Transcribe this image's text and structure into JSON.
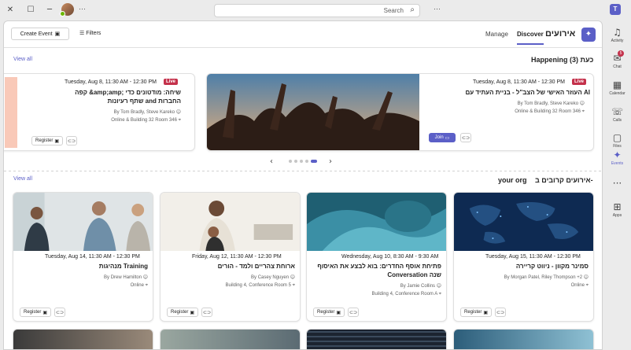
{
  "window": {
    "minimize": "─",
    "maximize": "☐",
    "close": "✕",
    "more": "···"
  },
  "search": {
    "placeholder": "Search"
  },
  "topbar": {
    "more": "···"
  },
  "rail": [
    {
      "label": "Activity",
      "icon": "bell-icon",
      "glyph": "🔔"
    },
    {
      "label": "Chat",
      "icon": "chat-icon",
      "glyph": "💬",
      "badge": "5"
    },
    {
      "label": "Calendar",
      "icon": "calendar-icon",
      "glyph": "📅"
    },
    {
      "label": "Calls",
      "icon": "phone-icon",
      "glyph": "☏"
    },
    {
      "label": "Files",
      "icon": "file-icon",
      "glyph": "📄"
    },
    {
      "label": "Events",
      "icon": "events-icon",
      "glyph": "✦"
    },
    {
      "label": "···",
      "icon": "more-icon",
      "glyph": ""
    },
    {
      "label": "Apps",
      "icon": "apps-icon",
      "glyph": "⊞"
    }
  ],
  "header": {
    "app_title": "אירועים",
    "tabs": [
      "Discover",
      "Manage"
    ],
    "filters": "Filters",
    "create_event": "Create Event"
  },
  "happening": {
    "title": "Happening כעת (3)",
    "view_all": "View all",
    "cards": [
      {
        "live": "Live",
        "date": "Tuesday, Aug 8, 11:30 AM - 12:30 PM",
        "title_line1": "העוזר האישי של הצב\"ל - בניית העתיד עם AI",
        "organizers": "By Tom Bradly, Steve Kareko",
        "location": "Online & Building 32 Room 346",
        "join": "Join"
      },
      {
        "live": "Live",
        "date": "Tuesday, Aug 8, 11:30 AM - 12:30 PM",
        "title_line1": "קפה &amp;amp; שיחה: מודטונים כדי",
        "title_line2": "שתף רעיונות and החברות",
        "organizers": "By Tom Bradly, Steve Kareko",
        "location": "Online & Building 32 Room 346",
        "register": "Register"
      }
    ]
  },
  "nearby": {
    "title": "אירועים קרובים ב-",
    "org": "your org",
    "view_all": "View all",
    "cards": [
      {
        "date": "Tuesday, Aug 15, 11:30 AM - 12:30 PM",
        "title_line1": "סמינר מקוון - ניווט קריירה",
        "organizers": "By Morgan Patel, Riley Thompson +2",
        "location": "Online",
        "register": "Register"
      },
      {
        "date": "Wednesday, Aug 10, 8:30 AM - 9:30 AM",
        "title_line1": "פתיחת אוסף החדרים: בוא לבצע את האיסוף",
        "title_line2": "Conversation שנה",
        "organizers": "By Jamie Collins",
        "location": "Building 4, Conference Room A",
        "register": "Register"
      },
      {
        "date": "Friday, Aug 12, 11:30 AM - 12:30 PM",
        "title_line1": "ארוחת צהריים ולמד - הורים",
        "organizers": "By Casey Nguyen",
        "location": "Building 4, Conference Room 5",
        "register": "Register"
      },
      {
        "date": "Tuesday, Aug 14, 11:30 AM - 12:30 PM",
        "title_line1": "מנהיגות Training",
        "organizers": "By Drew Hamilton",
        "location": "Online",
        "register": "Register"
      }
    ]
  },
  "colors": {
    "brand": "#5b5fc7",
    "live": "#c4314b"
  }
}
